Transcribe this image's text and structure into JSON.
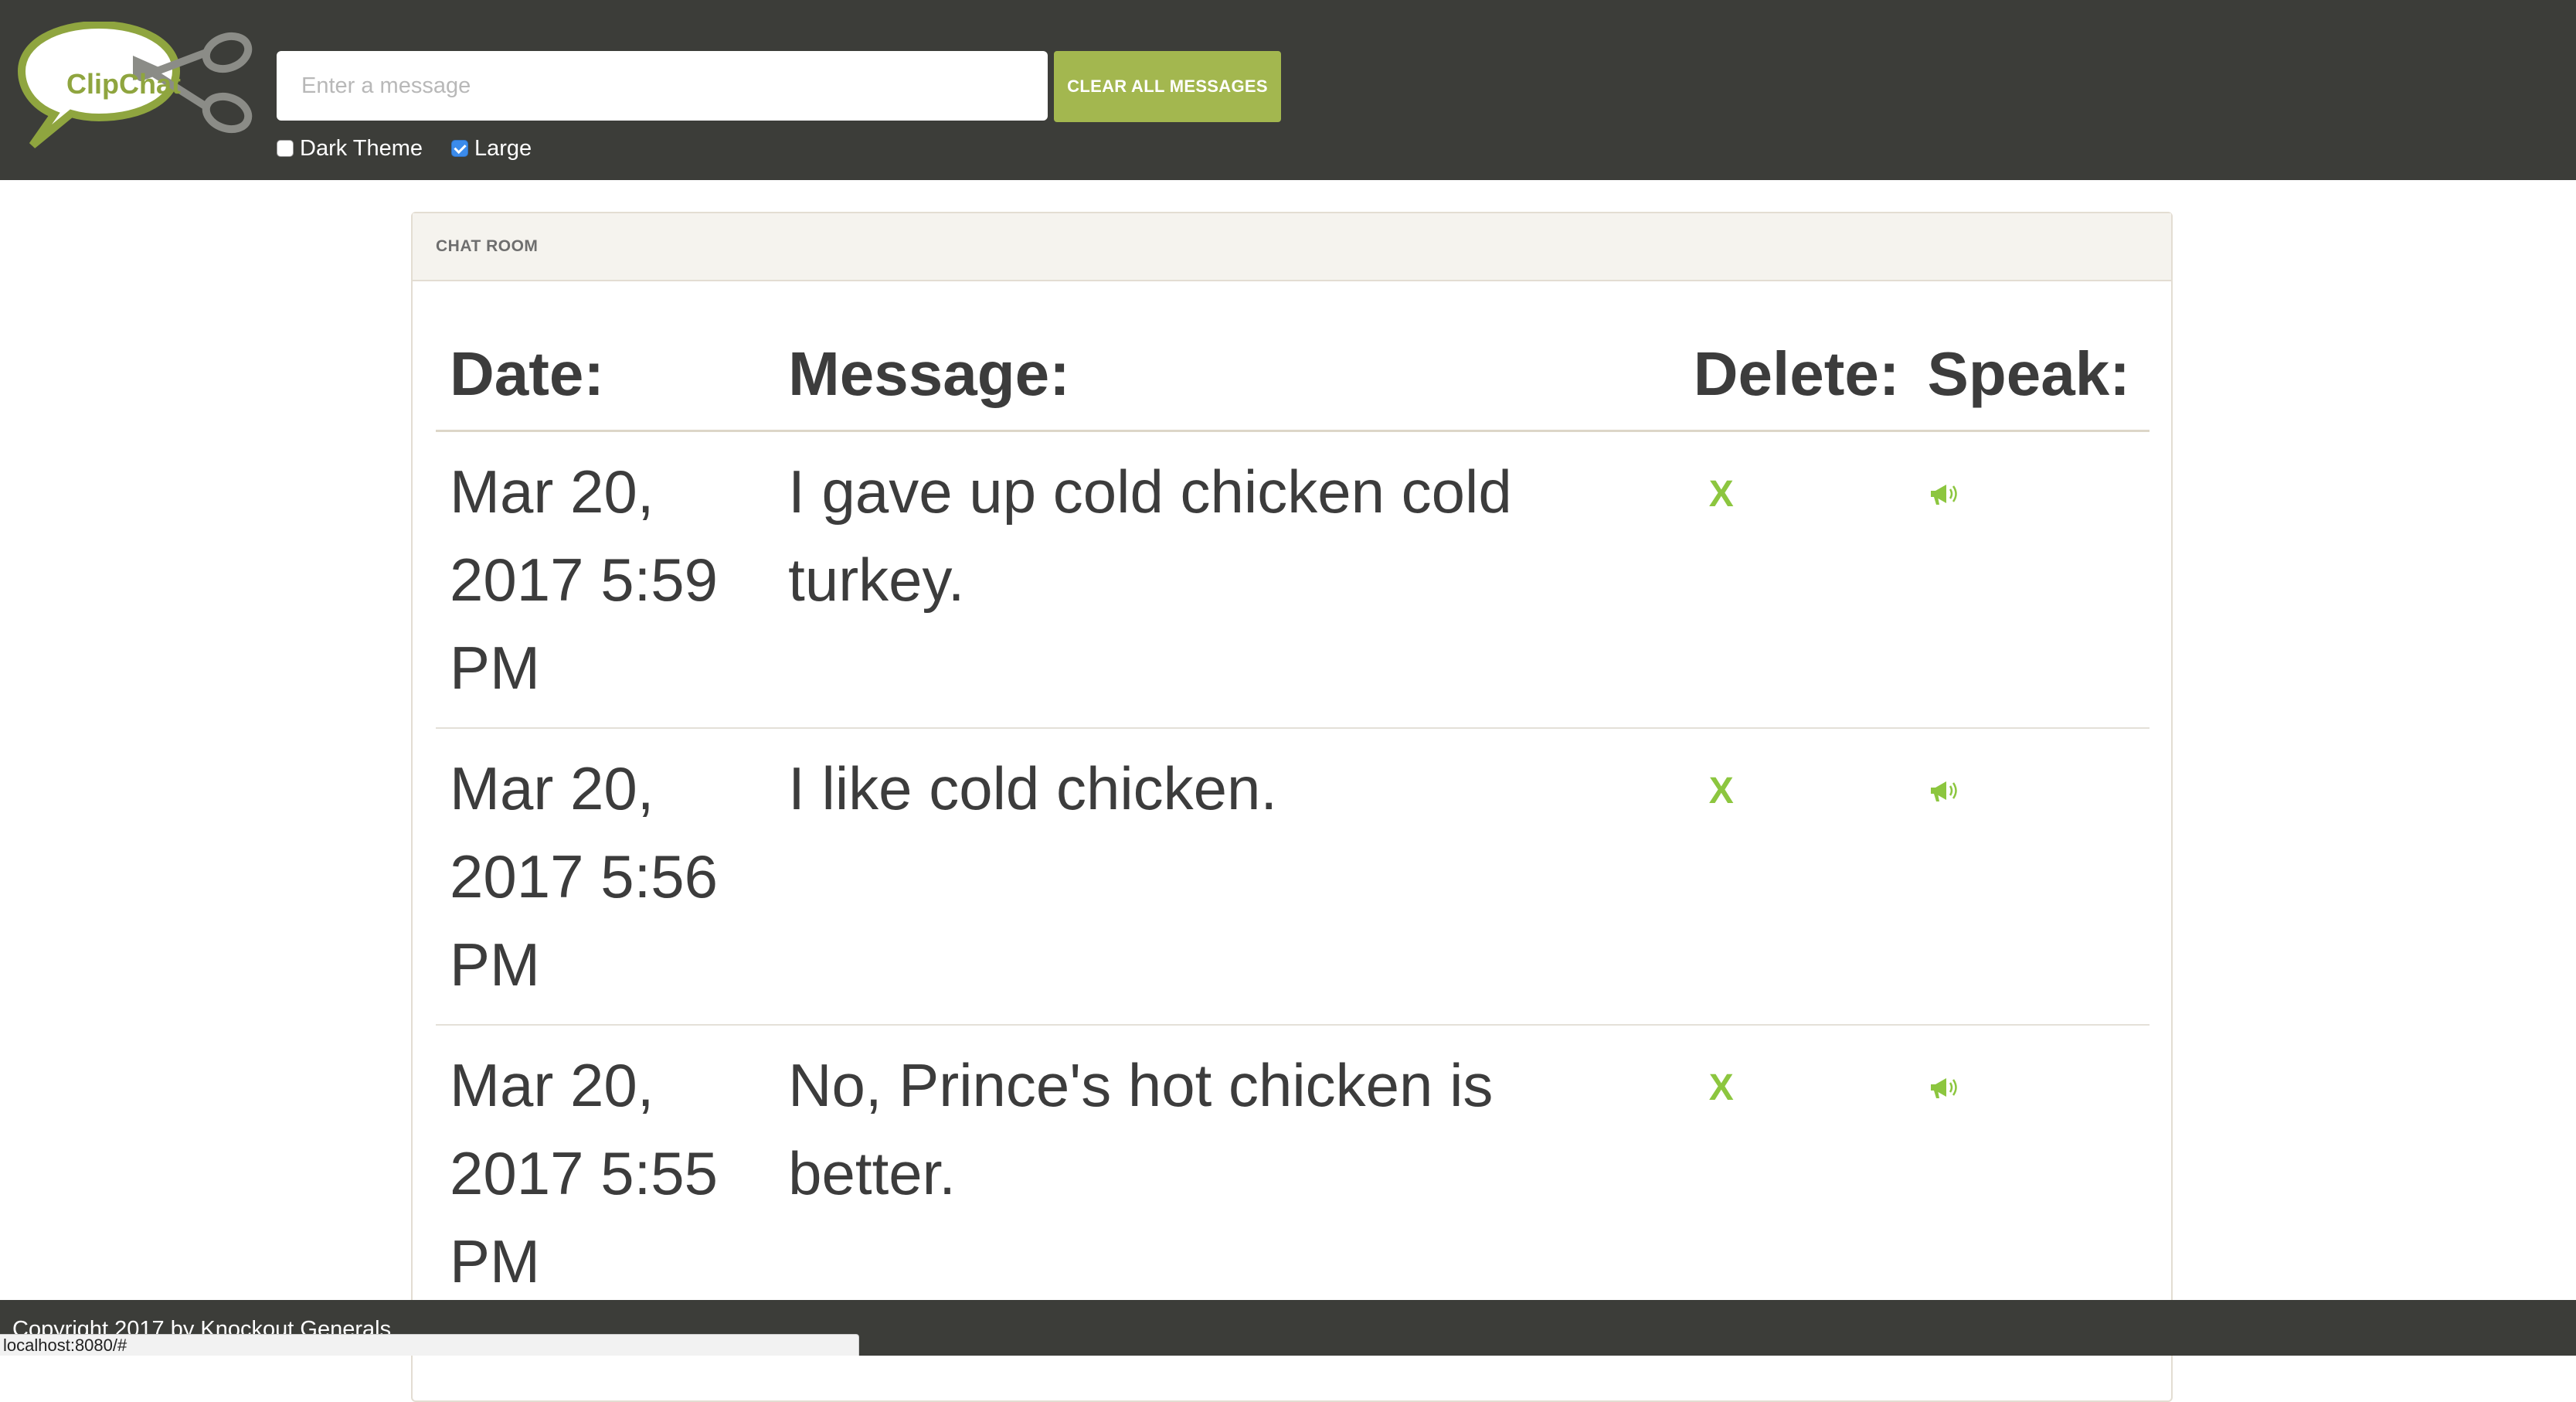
{
  "header": {
    "logo_text": "ClipChat",
    "message_placeholder": "Enter a message",
    "message_value": "",
    "clear_button_label": "CLEAR ALL MESSAGES",
    "options": {
      "dark_theme_label": "Dark Theme",
      "dark_theme_checked": false,
      "large_label": "Large",
      "large_checked": true
    }
  },
  "panel": {
    "title": "CHAT ROOM",
    "columns": {
      "date": "Date:",
      "message": "Message:",
      "delete": "Delete:",
      "speak": "Speak:"
    },
    "rows": [
      {
        "date": "Mar 20, 2017 5:59 PM",
        "message": "I gave up cold chicken cold turkey.",
        "delete_icon": "x-icon",
        "speak_icon": "megaphone-icon"
      },
      {
        "date": "Mar 20, 2017 5:56 PM",
        "message": "I like cold chicken.",
        "delete_icon": "x-icon",
        "speak_icon": "megaphone-icon"
      },
      {
        "date": "Mar 20, 2017 5:55 PM",
        "message": "No, Prince's hot chicken is better.",
        "delete_icon": "x-icon",
        "speak_icon": "megaphone-icon"
      }
    ]
  },
  "footer": {
    "copyright": "Copyright 2017 by Knockout Generals"
  },
  "status_bar": {
    "url": "localhost:8080/#"
  },
  "colors": {
    "header_bg": "#3c3d39",
    "accent_green": "#a3b74f",
    "icon_green": "#8cc63f",
    "checkbox_blue": "#3b8beb"
  }
}
